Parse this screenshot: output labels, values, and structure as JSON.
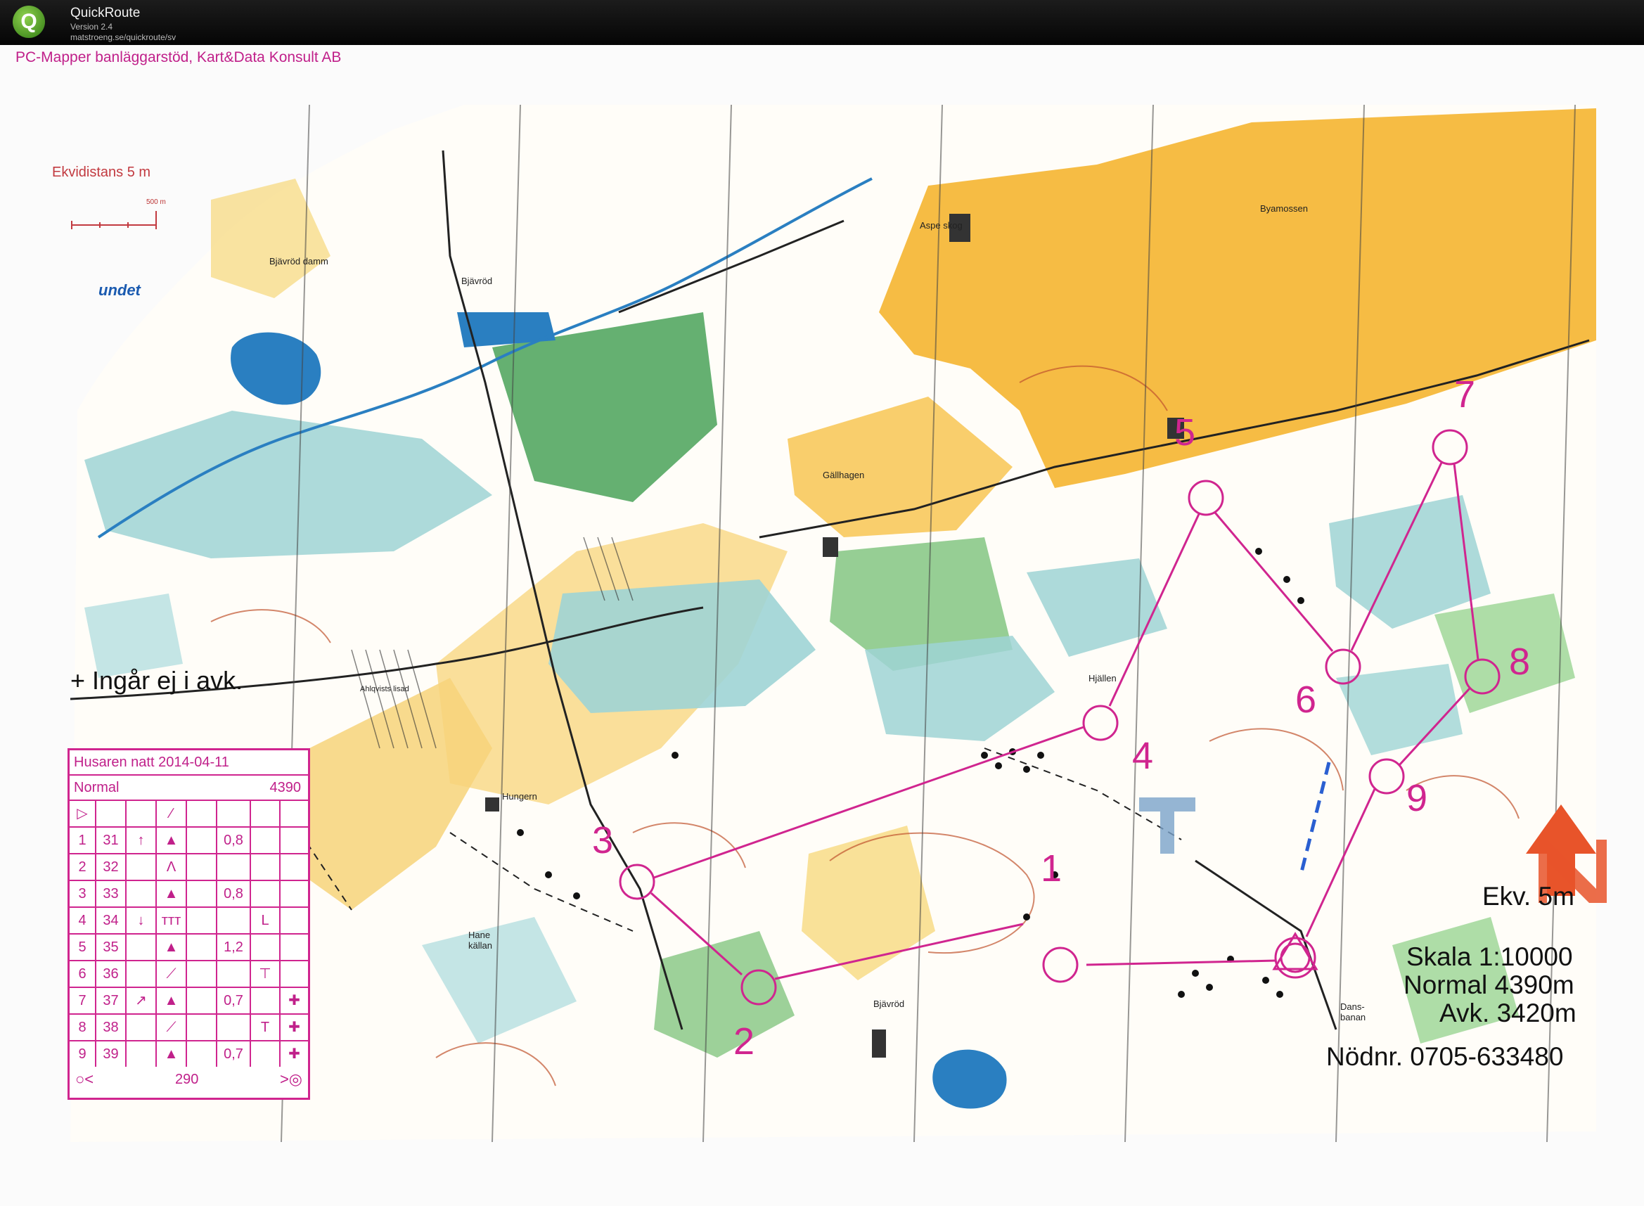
{
  "window": {
    "app_name": "QuickRoute",
    "version": "Version 2.4",
    "url": "matstroeng.se/quickroute/sv",
    "logo_letter": "Q"
  },
  "map": {
    "header_credit": "PC-Mapper banläggarstöd, Kart&Data Konsult AB",
    "ekvidistans_top": "Ekvidistans 5 m",
    "scalebar_label": "500 m",
    "edge_label": "undet",
    "note_not_in_distance": "+ Ingår ej i avk.",
    "ekv_right": "Ekv. 5m",
    "scale": "Skala 1:10000",
    "normal_length": "Normal 4390m",
    "avk_length": "Avk. 3420m",
    "emergency": "Nödnr. 0705-633480",
    "place_names": [
      "Bjävröd",
      "Bjävröd damm",
      "Aspe skog",
      "Byamossen",
      "Gällhagen",
      "Hjällen",
      "Hungern",
      "Hane källan",
      "Bjävröd",
      "Dans-banan",
      "Ahlqvists lisad"
    ],
    "control_numbers": [
      "1",
      "2",
      "3",
      "4",
      "5",
      "6",
      "7",
      "8",
      "9"
    ],
    "colors": {
      "course": "#d0258f",
      "water": "#2a7fc1",
      "open_land": "#f5b93a",
      "forest_green": "#3f9c4f",
      "contour": "#c0532e"
    }
  },
  "description": {
    "title": "Husaren natt 2014-04-11",
    "class": "Normal",
    "length": "4390",
    "start_symbol": "▷",
    "rows": [
      {
        "n": "1",
        "code": "31",
        "dir": "↑",
        "feat": "▲",
        "dim": "0,8",
        "pos": "",
        "extra": ""
      },
      {
        "n": "2",
        "code": "32",
        "dir": "",
        "feat": "Λ",
        "dim": "",
        "pos": "",
        "extra": ""
      },
      {
        "n": "3",
        "code": "33",
        "dir": "",
        "feat": "▲",
        "dim": "0,8",
        "pos": "",
        "extra": ""
      },
      {
        "n": "4",
        "code": "34",
        "dir": "↓",
        "feat": "ттт",
        "dim": "",
        "pos": "L",
        "extra": ""
      },
      {
        "n": "5",
        "code": "35",
        "dir": "",
        "feat": "▲",
        "dim": "1,2",
        "pos": "",
        "extra": ""
      },
      {
        "n": "6",
        "code": "36",
        "dir": "",
        "feat": "⟋",
        "dim": "",
        "pos": "⊤",
        "extra": ""
      },
      {
        "n": "7",
        "code": "37",
        "dir": "↗",
        "feat": "▲",
        "dim": "0,7",
        "pos": "",
        "extra": "✚"
      },
      {
        "n": "8",
        "code": "38",
        "dir": "",
        "feat": "⟋",
        "dim": "",
        "pos": "T",
        "extra": "✚"
      },
      {
        "n": "9",
        "code": "39",
        "dir": "",
        "feat": "▲",
        "dim": "0,7",
        "pos": "",
        "extra": "✚"
      }
    ],
    "finish_distance": "290"
  }
}
